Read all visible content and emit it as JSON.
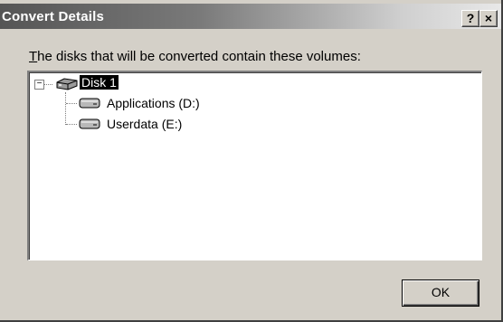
{
  "window": {
    "title": "Convert Details",
    "help_button": "?",
    "close_button": "×"
  },
  "description": {
    "underlined_char": "T",
    "rest": "he disks that will be converted contain these volumes:"
  },
  "tree": {
    "expander": "−",
    "root": {
      "label": "Disk 1",
      "icon": "disk-icon",
      "selected": true
    },
    "children": [
      {
        "label": "Applications (D:)",
        "icon": "volume-icon"
      },
      {
        "label": "Userdata (E:)",
        "icon": "volume-icon"
      }
    ]
  },
  "ok_button": "OK"
}
